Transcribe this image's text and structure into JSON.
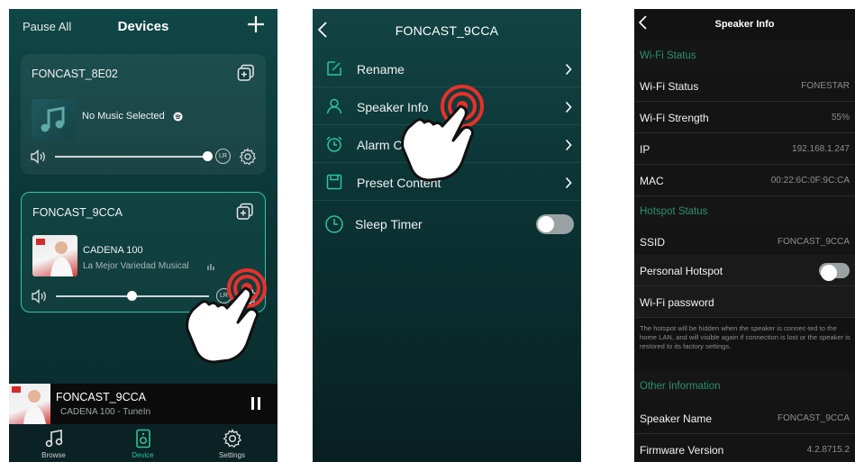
{
  "devices_screen": {
    "pause_all": "Pause All",
    "title": "Devices",
    "device1": {
      "name": "FONCAST_8E02",
      "track": "No Music Selected",
      "volume": 0.95
    },
    "device2": {
      "name": "FONCAST_9CCA",
      "track": "CADENA 100",
      "subtitle": "La Mejor Variedad Musical",
      "volume": 0.5
    },
    "lr_label": "LR",
    "now_playing": {
      "name": "FONCAST_9CCA",
      "subtitle": "CADENA 100 - TuneIn"
    },
    "tabs": [
      {
        "label": "Browse"
      },
      {
        "label": "Device"
      },
      {
        "label": "Settings"
      }
    ],
    "accent": "#2cc59c"
  },
  "device_menu": {
    "title": "FONCAST_9CCA",
    "items": [
      {
        "label": "Rename"
      },
      {
        "label": "Speaker Info"
      },
      {
        "label": "Alarm Clock"
      },
      {
        "label": "Preset Content"
      },
      {
        "label": "Sleep Timer"
      }
    ]
  },
  "speaker_info": {
    "title": "Speaker Info",
    "wifi_section": "Wi-Fi Status",
    "wifi_rows": [
      {
        "key": "Wi-Fi Status",
        "value": "FONESTAR"
      },
      {
        "key": "Wi-Fi Strength",
        "value": "55%"
      },
      {
        "key": "IP",
        "value": "192.168.1.247"
      },
      {
        "key": "MAC",
        "value": "00:22:6C:0F:9C:CA"
      }
    ],
    "hotspot_section": "Hotspot Status",
    "ssid": {
      "key": "SSID",
      "value": "FONCAST_9CCA"
    },
    "personal_hotspot": "Personal Hotspot",
    "wifi_password": "Wi-Fi password",
    "hotspot_note": "The hotspot will be hidden when the speaker is connec-ted to the home LAN, and will visible again if connection is lost or the speaker is restored to its factory settings.",
    "other_section": "Other Information",
    "other_rows": [
      {
        "key": "Speaker Name",
        "value": "FONCAST_9CCA"
      },
      {
        "key": "Firmware Version",
        "value": "4.2.8715.2"
      }
    ],
    "section_color": "#2a8f6f"
  }
}
